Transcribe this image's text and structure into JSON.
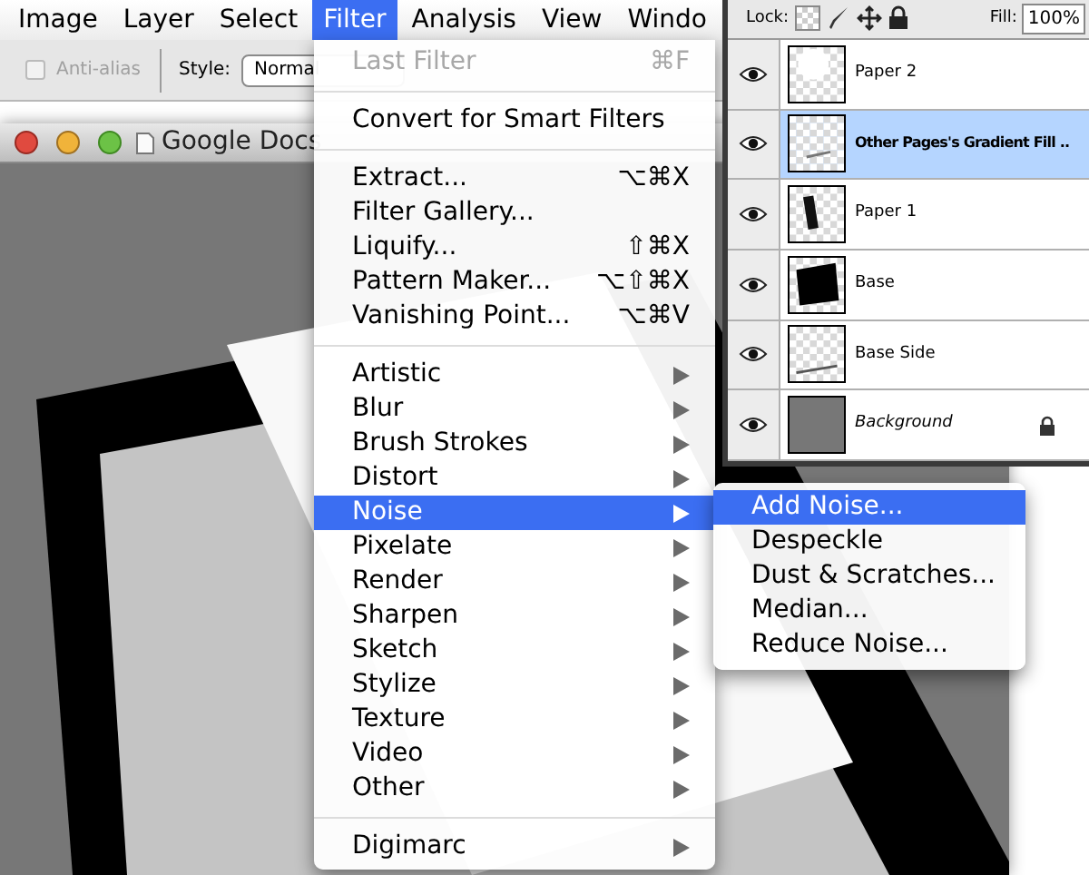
{
  "menu_bar": {
    "items": [
      {
        "label": "Image",
        "selected": false
      },
      {
        "label": "Layer",
        "selected": false
      },
      {
        "label": "Select",
        "selected": false
      },
      {
        "label": "Filter",
        "selected": true
      },
      {
        "label": "Analysis",
        "selected": false
      },
      {
        "label": "View",
        "selected": false
      },
      {
        "label": "Windo",
        "selected": false
      }
    ]
  },
  "options_bar": {
    "anti_alias": {
      "label": "Anti-alias",
      "checked": false,
      "disabled": true
    },
    "style": {
      "label": "Style:",
      "value": "Normal"
    }
  },
  "document_window": {
    "title": "Google Docs"
  },
  "filter_menu": {
    "sections": [
      [
        {
          "label": "Last Filter",
          "shortcut": "⌘F",
          "kind": "command",
          "disabled": true,
          "selected": false
        }
      ],
      [
        {
          "label": "Convert for Smart Filters",
          "kind": "command",
          "disabled": false,
          "selected": false
        }
      ],
      [
        {
          "label": "Extract...",
          "shortcut": "⌥⌘X",
          "kind": "command",
          "disabled": false,
          "selected": false
        },
        {
          "label": "Filter Gallery...",
          "kind": "command",
          "disabled": false,
          "selected": false
        },
        {
          "label": "Liquify...",
          "shortcut": "⇧⌘X",
          "kind": "command",
          "disabled": false,
          "selected": false
        },
        {
          "label": "Pattern Maker...",
          "shortcut": "⌥⇧⌘X",
          "kind": "command",
          "disabled": false,
          "selected": false
        },
        {
          "label": "Vanishing Point...",
          "shortcut": "⌥⌘V",
          "kind": "command",
          "disabled": false,
          "selected": false
        }
      ],
      [
        {
          "label": "Artistic",
          "kind": "submenu",
          "disabled": false,
          "selected": false
        },
        {
          "label": "Blur",
          "kind": "submenu",
          "disabled": false,
          "selected": false
        },
        {
          "label": "Brush Strokes",
          "kind": "submenu",
          "disabled": false,
          "selected": false
        },
        {
          "label": "Distort",
          "kind": "submenu",
          "disabled": false,
          "selected": false
        },
        {
          "label": "Noise",
          "kind": "submenu",
          "disabled": false,
          "selected": true
        },
        {
          "label": "Pixelate",
          "kind": "submenu",
          "disabled": false,
          "selected": false
        },
        {
          "label": "Render",
          "kind": "submenu",
          "disabled": false,
          "selected": false
        },
        {
          "label": "Sharpen",
          "kind": "submenu",
          "disabled": false,
          "selected": false
        },
        {
          "label": "Sketch",
          "kind": "submenu",
          "disabled": false,
          "selected": false
        },
        {
          "label": "Stylize",
          "kind": "submenu",
          "disabled": false,
          "selected": false
        },
        {
          "label": "Texture",
          "kind": "submenu",
          "disabled": false,
          "selected": false
        },
        {
          "label": "Video",
          "kind": "submenu",
          "disabled": false,
          "selected": false
        },
        {
          "label": "Other",
          "kind": "submenu",
          "disabled": false,
          "selected": false
        }
      ],
      [
        {
          "label": "Digimarc",
          "kind": "submenu",
          "disabled": false,
          "selected": false
        }
      ]
    ]
  },
  "noise_submenu": {
    "items": [
      {
        "label": "Add Noise...",
        "selected": true
      },
      {
        "label": "Despeckle",
        "selected": false
      },
      {
        "label": "Dust & Scratches...",
        "selected": false
      },
      {
        "label": "Median...",
        "selected": false
      },
      {
        "label": "Reduce Noise...",
        "selected": false
      }
    ]
  },
  "layers_panel": {
    "lock_label": "Lock:",
    "fill_label": "Fill:",
    "fill_value": "100%",
    "layers": [
      {
        "name": "Paper 2",
        "kind": "layer",
        "selected": false,
        "visible": true,
        "locked": false
      },
      {
        "name": "Other Pages's Gradient Fill ..",
        "kind": "layer",
        "selected": true,
        "visible": true,
        "locked": false
      },
      {
        "name": "Paper 1",
        "kind": "layer",
        "selected": false,
        "visible": true,
        "locked": false
      },
      {
        "name": "Base",
        "kind": "layer",
        "selected": false,
        "visible": true,
        "locked": false
      },
      {
        "name": "Base Side",
        "kind": "layer",
        "selected": false,
        "visible": true,
        "locked": false
      },
      {
        "name": "Background",
        "kind": "background",
        "selected": false,
        "visible": true,
        "locked": true
      }
    ]
  }
}
